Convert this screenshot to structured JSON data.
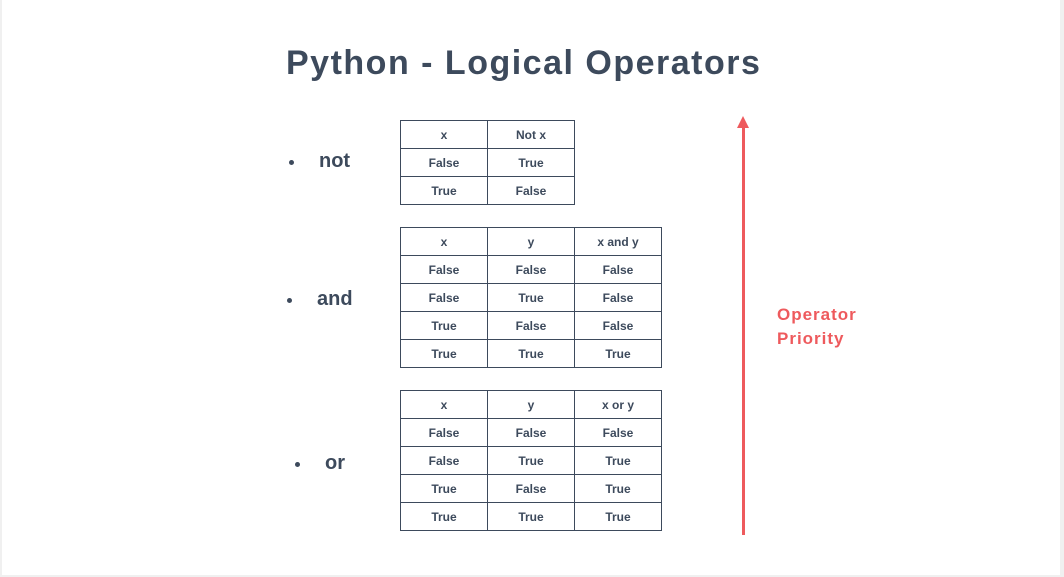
{
  "title": "Python - Logical Operators",
  "operators": [
    {
      "name": "not",
      "headers": [
        "x",
        "Not x"
      ],
      "rows": [
        [
          "False",
          "True"
        ],
        [
          "True",
          "False"
        ]
      ]
    },
    {
      "name": "and",
      "headers": [
        "x",
        "y",
        "x and y"
      ],
      "rows": [
        [
          "False",
          "False",
          "False"
        ],
        [
          "False",
          "True",
          "False"
        ],
        [
          "True",
          "False",
          "False"
        ],
        [
          "True",
          "True",
          "True"
        ]
      ]
    },
    {
      "name": "or",
      "headers": [
        "x",
        "y",
        "x or y"
      ],
      "rows": [
        [
          "False",
          "False",
          "False"
        ],
        [
          "False",
          "True",
          "True"
        ],
        [
          "True",
          "False",
          "True"
        ],
        [
          "True",
          "True",
          "True"
        ]
      ]
    }
  ],
  "priority": {
    "line1": "Operator",
    "line2": "Priority",
    "color": "#ee5a5d"
  },
  "colors": {
    "text": "#3d4a5c",
    "accent": "#ee5a5d"
  }
}
